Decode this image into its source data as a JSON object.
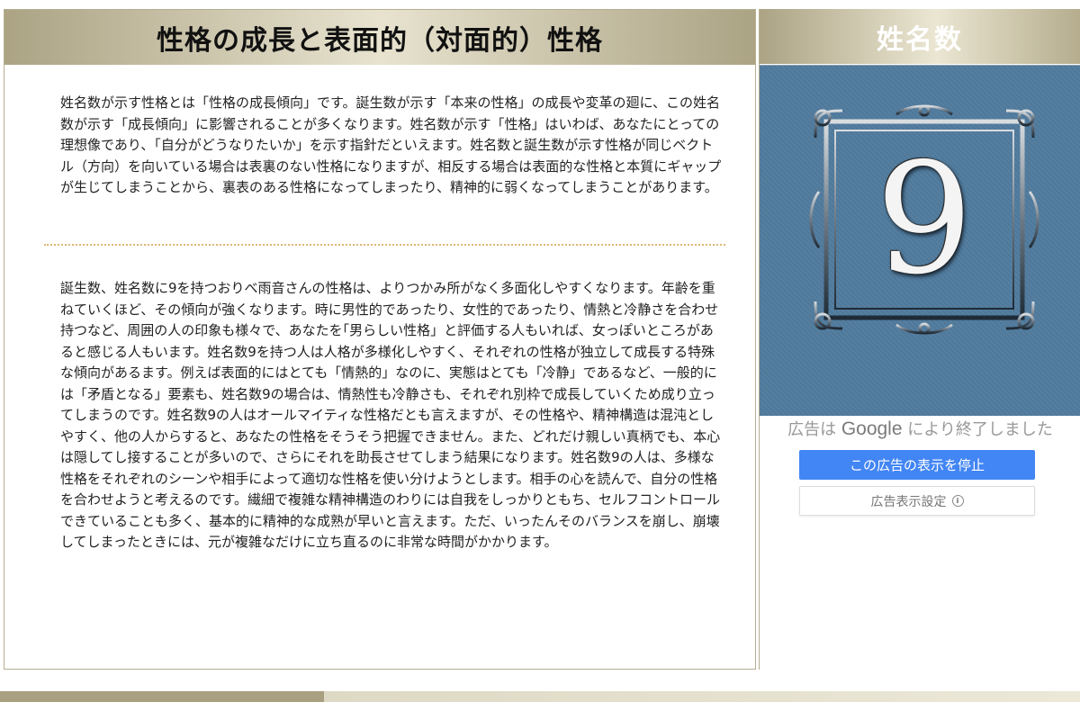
{
  "main": {
    "title": "性格の成長と表面的（対面的）性格",
    "paragraph1": "姓名数が示す性格とは「性格の成長傾向」です。誕生数が示す「本来の性格」の成長や変革の廻に、この姓名数が示す「成長傾向」に影響されることが多くなります。姓名数が示す「性格」はいわば、あなたにとっての理想像であり、「自分がどうなりたいか」を示す指針だといえます。姓名数と誕生数が示す性格が同じベクトル（方向）を向いている場合は表裏のない性格になりますが、相反する場合は表面的な性格と本質にギャップが生じてしまうことから、裏表のある性格になってしまったり、精神的に弱くなってしまうことがあります。",
    "paragraph2": "誕生数、姓名数に9を持つおりべ雨音さんの性格は、よりつかみ所がなく多面化しやすくなります。年齢を重ねていくほど、その傾向が強くなります。時に男性的であったり、女性的であったり、情熱と冷静さを合わせ持つなど、周囲の人の印象も様々で、あなたを｢男らしい性格」と評価する人もいれば、女っぽいところがあると感じる人もいます。姓名数9を持つ人は人格が多様化しやすく、それぞれの性格が独立して成長する特殊な傾向があるます。例えば表面的にはとても「情熱的」なのに、実態はとても「冷静」であるなど、一般的には「矛盾となる」要素も、姓名数9の場合は、情熱性も冷静さも、それぞれ別枠で成長していくため成り立ってしまうのです。姓名数9の人はオールマイティな性格だとも言えますが、その性格や、精神構造は混沌としやすく、他の人からすると、あなたの性格をそうそう把握できません。また、どれだけ親しい真柄でも、本心は隠してし接することが多いので、さらにそれを助長させてしまう結果になります。姓名数9の人は、多様な性格をそれぞれのシーンや相手によって適切な性格を使い分けようとします。相手の心を読んで、自分の性格を合わせようと考えるのです。繊細で複雑な精神構造のわりには自我をしっかりともち、セルフコントロールできていることも多く、基本的に精神的な成熟が早いと言えます。ただ、いったんそのバランスを崩し、崩壊してしまったときには、元が複雑なだけに立ち直るのに非常な時間がかかります。"
  },
  "side": {
    "title": "姓名数",
    "number": "9",
    "frame_icon": "ornate-frame-icon"
  },
  "ad": {
    "ended_prefix": "広告は",
    "ended_brand": "Google",
    "ended_suffix": "により終了しました",
    "stop_button": "この広告の表示を停止",
    "settings_button": "広告表示設定",
    "info_glyph": "i"
  },
  "colors": {
    "header_gold": "#aba384",
    "tile_blue": "#557fa1",
    "ad_button_blue": "#4285f4",
    "divider_orange": "#e0b577"
  }
}
